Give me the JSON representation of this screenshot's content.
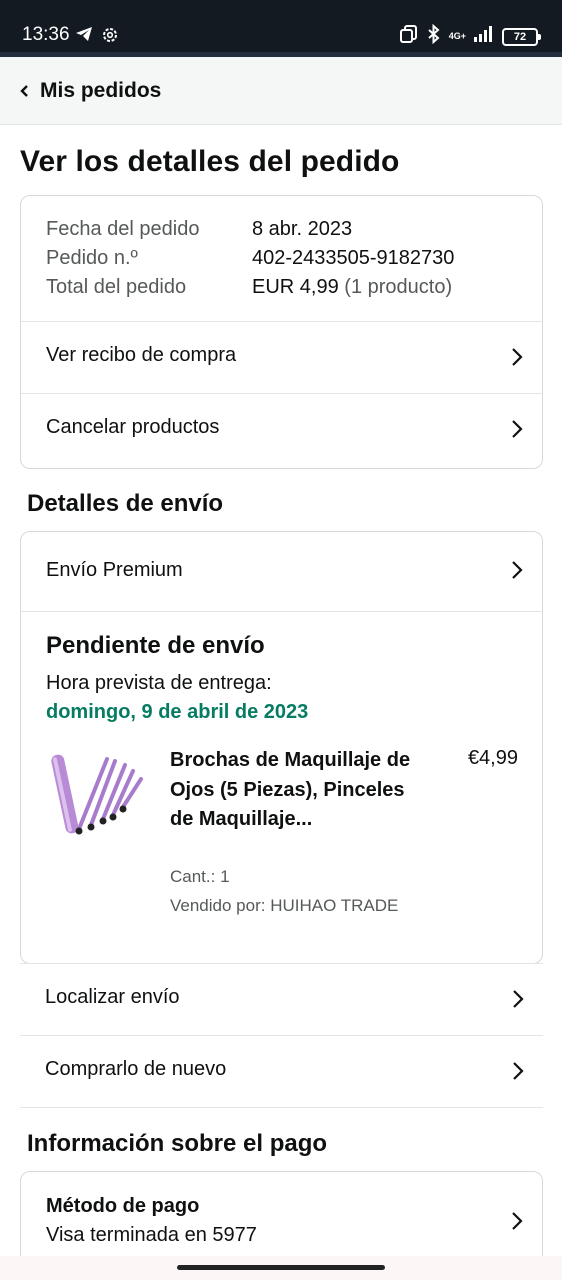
{
  "status_bar": {
    "time": "13:36",
    "network": "4G+",
    "battery": "72",
    "icons": [
      "telegram-icon",
      "gear-icon",
      "sim-icon",
      "bluetooth-icon",
      "signal-icon",
      "battery-icon"
    ]
  },
  "header": {
    "back_label": "Mis pedidos"
  },
  "page": {
    "title": "Ver los detalles del pedido"
  },
  "order_summary": {
    "rows": [
      {
        "label": "Fecha del pedido",
        "value": "8 abr. 2023"
      },
      {
        "label": "Pedido n.º",
        "value": "402-2433505-9182730"
      },
      {
        "label": "Total del pedido",
        "value": "EUR 4,99",
        "extra": "(1 producto)"
      }
    ],
    "links": [
      {
        "label": "Ver recibo de compra"
      },
      {
        "label": "Cancelar productos"
      }
    ]
  },
  "shipping": {
    "section_title": "Detalles de envío",
    "method": "Envío Premium",
    "status": "Pendiente de envío",
    "eta_label": "Hora prevista de entrega:",
    "eta_date": "domingo, 9 de abril de 2023",
    "product": {
      "name": "Brochas de Maquillaje de Ojos (5 Piezas), Pinceles de Maquillaje...",
      "price": "€4,99",
      "qty": "Cant.: 1",
      "seller": "Vendido por: HUIHAO TRADE"
    },
    "actions": [
      {
        "label": "Localizar envío"
      },
      {
        "label": "Comprarlo de nuevo"
      }
    ]
  },
  "payment": {
    "section_title": "Información sobre el pago",
    "method_title": "Método de pago",
    "method_detail": "Visa terminada en 5977"
  },
  "colors": {
    "status_bar_bg": "#131a22",
    "delivery_green": "#067d62",
    "text": "#0f1111",
    "muted": "#565959",
    "border": "#d5d9d9"
  }
}
